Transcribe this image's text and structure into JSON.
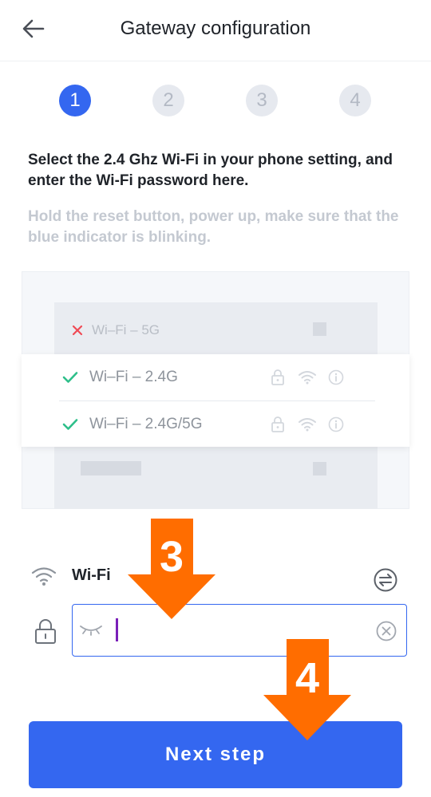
{
  "header": {
    "title": "Gateway configuration"
  },
  "stepper": {
    "steps": [
      "1",
      "2",
      "3",
      "4"
    ],
    "active": 0
  },
  "instructions": {
    "main": "Select the 2.4 Ghz Wi-Fi in your phone setting, and enter the Wi-Fi password here.",
    "hint": "Hold the reset button, power up, make sure that the blue indicator is blinking."
  },
  "illustration": {
    "networks": [
      {
        "name": "Wi–Fi – 5G",
        "supported": false
      },
      {
        "name": "Wi–Fi – 2.4G",
        "supported": true
      },
      {
        "name": "Wi–Fi – 2.4G/5G",
        "supported": true
      }
    ]
  },
  "form": {
    "wifi_name": "Wi-Fi",
    "password_value": ""
  },
  "callouts": {
    "arrow_3": "3",
    "arrow_4": "4"
  },
  "footer": {
    "next_label": "Next step"
  },
  "colors": {
    "primary": "#3467f0",
    "callout_orange": "#ff6d00",
    "check_green": "#2ebf8a",
    "cross_red": "#f04a55"
  }
}
